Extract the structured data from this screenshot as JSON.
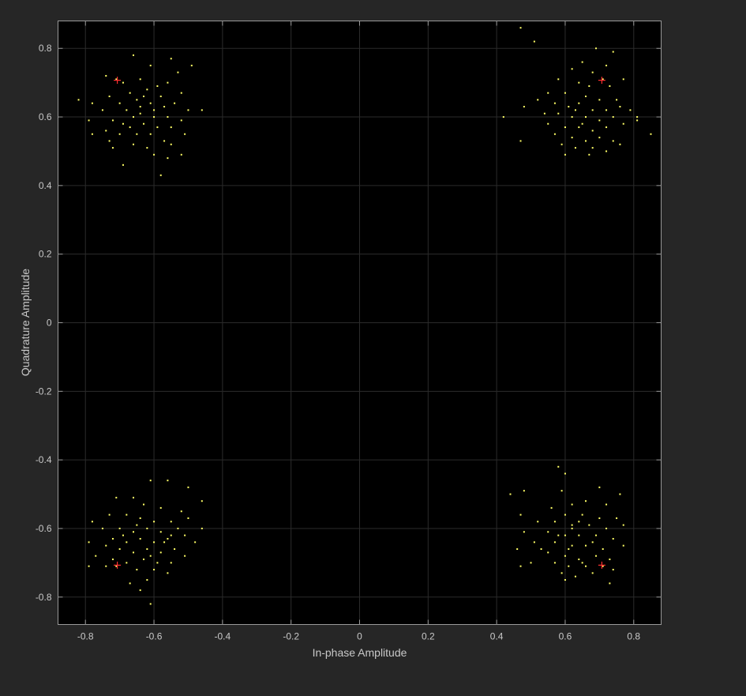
{
  "chart_data": {
    "type": "scatter",
    "title": "",
    "xlabel": "In-phase Amplitude",
    "ylabel": "Quadrature Amplitude",
    "xlim": [
      -0.88,
      0.88
    ],
    "ylim": [
      -0.88,
      0.88
    ],
    "xticks": [
      -0.8,
      -0.6,
      -0.4,
      -0.2,
      0,
      0.2,
      0.4,
      0.6,
      0.8
    ],
    "yticks": [
      -0.8,
      -0.6,
      -0.4,
      -0.2,
      0,
      0.2,
      0.4,
      0.6,
      0.8
    ],
    "grid": true,
    "background": "#000000",
    "series": [
      {
        "marker": "dot",
        "color": "#ffff66",
        "cluster_centers": [
          [
            -0.62,
            0.62
          ],
          [
            0.62,
            0.62
          ],
          [
            -0.62,
            -0.63
          ],
          [
            0.63,
            -0.62
          ]
        ],
        "points": [
          [
            -0.71,
            0.71
          ],
          [
            -0.66,
            0.78
          ],
          [
            -0.61,
            0.75
          ],
          [
            -0.55,
            0.77
          ],
          [
            -0.49,
            0.75
          ],
          [
            -0.53,
            0.73
          ],
          [
            -0.74,
            0.72
          ],
          [
            -0.69,
            0.7
          ],
          [
            -0.64,
            0.71
          ],
          [
            -0.59,
            0.69
          ],
          [
            -0.56,
            0.7
          ],
          [
            -0.67,
            0.67
          ],
          [
            -0.62,
            0.68
          ],
          [
            -0.58,
            0.66
          ],
          [
            -0.52,
            0.67
          ],
          [
            -0.73,
            0.66
          ],
          [
            -0.7,
            0.64
          ],
          [
            -0.65,
            0.65
          ],
          [
            -0.61,
            0.64
          ],
          [
            -0.57,
            0.63
          ],
          [
            -0.54,
            0.64
          ],
          [
            -0.5,
            0.62
          ],
          [
            -0.82,
            0.65
          ],
          [
            -0.78,
            0.64
          ],
          [
            -0.75,
            0.62
          ],
          [
            -0.68,
            0.62
          ],
          [
            -0.64,
            0.61
          ],
          [
            -0.6,
            0.62
          ],
          [
            -0.56,
            0.6
          ],
          [
            -0.52,
            0.59
          ],
          [
            -0.46,
            0.62
          ],
          [
            -0.72,
            0.59
          ],
          [
            -0.69,
            0.58
          ],
          [
            -0.66,
            0.6
          ],
          [
            -0.63,
            0.58
          ],
          [
            -0.59,
            0.57
          ],
          [
            -0.55,
            0.57
          ],
          [
            -0.79,
            0.59
          ],
          [
            -0.74,
            0.56
          ],
          [
            -0.7,
            0.55
          ],
          [
            -0.65,
            0.55
          ],
          [
            -0.61,
            0.55
          ],
          [
            -0.57,
            0.53
          ],
          [
            -0.51,
            0.55
          ],
          [
            -0.78,
            0.55
          ],
          [
            -0.73,
            0.53
          ],
          [
            -0.66,
            0.52
          ],
          [
            -0.62,
            0.51
          ],
          [
            -0.55,
            0.52
          ],
          [
            -0.72,
            0.51
          ],
          [
            -0.6,
            0.49
          ],
          [
            -0.52,
            0.49
          ],
          [
            -0.56,
            0.48
          ],
          [
            -0.69,
            0.46
          ],
          [
            -0.58,
            0.43
          ],
          [
            -0.64,
            0.63
          ],
          [
            -0.6,
            0.6
          ],
          [
            -0.67,
            0.57
          ],
          [
            -0.63,
            0.66
          ],
          [
            0.47,
            0.86
          ],
          [
            0.51,
            0.82
          ],
          [
            0.69,
            0.8
          ],
          [
            0.74,
            0.79
          ],
          [
            0.65,
            0.76
          ],
          [
            0.72,
            0.75
          ],
          [
            0.62,
            0.74
          ],
          [
            0.68,
            0.73
          ],
          [
            0.71,
            0.71
          ],
          [
            0.77,
            0.71
          ],
          [
            0.58,
            0.71
          ],
          [
            0.64,
            0.7
          ],
          [
            0.67,
            0.69
          ],
          [
            0.73,
            0.69
          ],
          [
            0.55,
            0.67
          ],
          [
            0.6,
            0.67
          ],
          [
            0.66,
            0.66
          ],
          [
            0.7,
            0.65
          ],
          [
            0.75,
            0.65
          ],
          [
            0.52,
            0.65
          ],
          [
            0.57,
            0.64
          ],
          [
            0.61,
            0.63
          ],
          [
            0.64,
            0.64
          ],
          [
            0.68,
            0.62
          ],
          [
            0.72,
            0.62
          ],
          [
            0.76,
            0.63
          ],
          [
            0.79,
            0.62
          ],
          [
            0.48,
            0.63
          ],
          [
            0.54,
            0.61
          ],
          [
            0.58,
            0.61
          ],
          [
            0.62,
            0.6
          ],
          [
            0.66,
            0.6
          ],
          [
            0.7,
            0.59
          ],
          [
            0.74,
            0.6
          ],
          [
            0.81,
            0.6
          ],
          [
            0.42,
            0.6
          ],
          [
            0.55,
            0.58
          ],
          [
            0.6,
            0.57
          ],
          [
            0.64,
            0.57
          ],
          [
            0.68,
            0.56
          ],
          [
            0.72,
            0.57
          ],
          [
            0.77,
            0.58
          ],
          [
            0.57,
            0.55
          ],
          [
            0.62,
            0.54
          ],
          [
            0.66,
            0.53
          ],
          [
            0.7,
            0.54
          ],
          [
            0.74,
            0.53
          ],
          [
            0.85,
            0.55
          ],
          [
            0.47,
            0.53
          ],
          [
            0.59,
            0.52
          ],
          [
            0.63,
            0.51
          ],
          [
            0.68,
            0.51
          ],
          [
            0.76,
            0.52
          ],
          [
            0.6,
            0.49
          ],
          [
            0.67,
            0.49
          ],
          [
            0.72,
            0.5
          ],
          [
            0.81,
            0.59
          ],
          [
            0.63,
            0.62
          ],
          [
            0.65,
            0.58
          ],
          [
            -0.56,
            -0.46
          ],
          [
            -0.61,
            -0.46
          ],
          [
            -0.46,
            -0.52
          ],
          [
            -0.66,
            -0.51
          ],
          [
            -0.71,
            -0.51
          ],
          [
            -0.5,
            -0.48
          ],
          [
            -0.63,
            -0.53
          ],
          [
            -0.58,
            -0.54
          ],
          [
            -0.52,
            -0.55
          ],
          [
            -0.68,
            -0.56
          ],
          [
            -0.73,
            -0.56
          ],
          [
            -0.64,
            -0.57
          ],
          [
            -0.6,
            -0.58
          ],
          [
            -0.55,
            -0.58
          ],
          [
            -0.5,
            -0.57
          ],
          [
            -0.78,
            -0.58
          ],
          [
            -0.75,
            -0.6
          ],
          [
            -0.7,
            -0.6
          ],
          [
            -0.66,
            -0.61
          ],
          [
            -0.62,
            -0.6
          ],
          [
            -0.58,
            -0.61
          ],
          [
            -0.53,
            -0.6
          ],
          [
            -0.46,
            -0.6
          ],
          [
            -0.72,
            -0.63
          ],
          [
            -0.68,
            -0.64
          ],
          [
            -0.64,
            -0.63
          ],
          [
            -0.6,
            -0.64
          ],
          [
            -0.56,
            -0.63
          ],
          [
            -0.51,
            -0.62
          ],
          [
            -0.48,
            -0.64
          ],
          [
            -0.79,
            -0.64
          ],
          [
            -0.74,
            -0.65
          ],
          [
            -0.7,
            -0.66
          ],
          [
            -0.66,
            -0.67
          ],
          [
            -0.62,
            -0.66
          ],
          [
            -0.58,
            -0.67
          ],
          [
            -0.54,
            -0.66
          ],
          [
            -0.77,
            -0.68
          ],
          [
            -0.72,
            -0.69
          ],
          [
            -0.68,
            -0.7
          ],
          [
            -0.63,
            -0.69
          ],
          [
            -0.59,
            -0.7
          ],
          [
            -0.55,
            -0.7
          ],
          [
            -0.51,
            -0.68
          ],
          [
            -0.71,
            -0.71
          ],
          [
            -0.79,
            -0.71
          ],
          [
            -0.74,
            -0.71
          ],
          [
            -0.65,
            -0.72
          ],
          [
            -0.6,
            -0.72
          ],
          [
            -0.56,
            -0.73
          ],
          [
            -0.62,
            -0.75
          ],
          [
            -0.67,
            -0.76
          ],
          [
            -0.64,
            -0.78
          ],
          [
            -0.61,
            -0.82
          ],
          [
            -0.57,
            -0.64
          ],
          [
            -0.65,
            -0.59
          ],
          [
            -0.61,
            -0.68
          ],
          [
            -0.69,
            -0.62
          ],
          [
            -0.55,
            -0.62
          ],
          [
            0.58,
            -0.42
          ],
          [
            0.6,
            -0.44
          ],
          [
            0.44,
            -0.5
          ],
          [
            0.48,
            -0.49
          ],
          [
            0.59,
            -0.49
          ],
          [
            0.7,
            -0.48
          ],
          [
            0.76,
            -0.5
          ],
          [
            0.66,
            -0.52
          ],
          [
            0.72,
            -0.53
          ],
          [
            0.62,
            -0.53
          ],
          [
            0.56,
            -0.54
          ],
          [
            0.47,
            -0.56
          ],
          [
            0.6,
            -0.56
          ],
          [
            0.65,
            -0.56
          ],
          [
            0.7,
            -0.57
          ],
          [
            0.75,
            -0.57
          ],
          [
            0.52,
            -0.58
          ],
          [
            0.57,
            -0.58
          ],
          [
            0.62,
            -0.59
          ],
          [
            0.67,
            -0.59
          ],
          [
            0.72,
            -0.6
          ],
          [
            0.77,
            -0.59
          ],
          [
            0.48,
            -0.61
          ],
          [
            0.55,
            -0.61
          ],
          [
            0.6,
            -0.62
          ],
          [
            0.64,
            -0.62
          ],
          [
            0.69,
            -0.62
          ],
          [
            0.74,
            -0.63
          ],
          [
            0.51,
            -0.64
          ],
          [
            0.57,
            -0.64
          ],
          [
            0.62,
            -0.65
          ],
          [
            0.66,
            -0.65
          ],
          [
            0.71,
            -0.66
          ],
          [
            0.77,
            -0.65
          ],
          [
            0.53,
            -0.66
          ],
          [
            0.46,
            -0.66
          ],
          [
            0.55,
            -0.67
          ],
          [
            0.6,
            -0.68
          ],
          [
            0.64,
            -0.69
          ],
          [
            0.69,
            -0.68
          ],
          [
            0.73,
            -0.69
          ],
          [
            0.5,
            -0.7
          ],
          [
            0.57,
            -0.7
          ],
          [
            0.61,
            -0.71
          ],
          [
            0.66,
            -0.71
          ],
          [
            0.71,
            -0.71
          ],
          [
            0.74,
            -0.72
          ],
          [
            0.47,
            -0.71
          ],
          [
            0.59,
            -0.73
          ],
          [
            0.63,
            -0.74
          ],
          [
            0.68,
            -0.73
          ],
          [
            0.73,
            -0.76
          ],
          [
            0.6,
            -0.75
          ],
          [
            0.65,
            -0.7
          ],
          [
            0.62,
            -0.6
          ],
          [
            0.58,
            -0.62
          ],
          [
            0.68,
            -0.64
          ],
          [
            0.64,
            -0.58
          ],
          [
            0.61,
            -0.66
          ]
        ]
      },
      {
        "marker": "plus",
        "color": "#ff3030",
        "points": [
          [
            -0.707,
            0.707
          ],
          [
            0.707,
            0.707
          ],
          [
            -0.707,
            -0.707
          ],
          [
            0.707,
            -0.707
          ]
        ]
      }
    ]
  }
}
